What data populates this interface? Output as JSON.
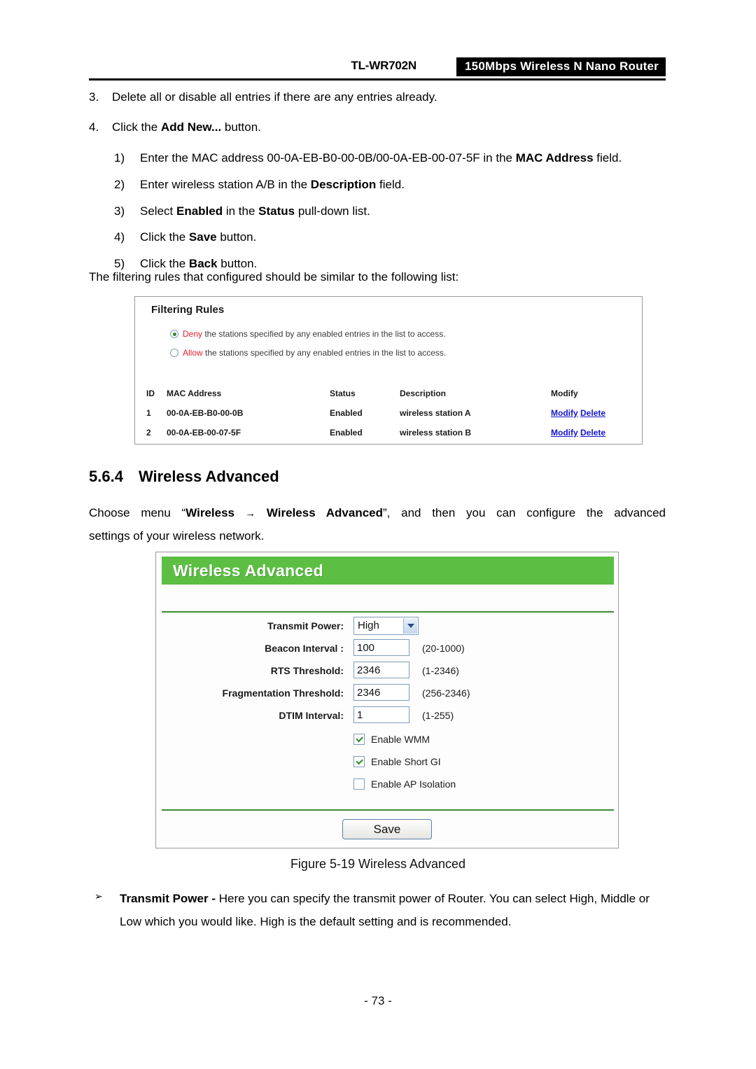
{
  "header": {
    "model": "TL-WR702N",
    "product": "150Mbps  Wireless  N  Nano  Router"
  },
  "outer_steps": [
    {
      "num": "3.",
      "text": "Delete all or disable all entries if there are any entries already."
    },
    {
      "num": "4.",
      "pre": "Click the ",
      "bold": "Add New...",
      "post": " button."
    }
  ],
  "inner_steps": [
    {
      "num": "1)",
      "p1": "Enter the MAC address ",
      "p2": "00-0A-EB-B0-00-0B/00-0A-EB-00-07-5F",
      "p3": " in the ",
      "b1": "MAC Address",
      "p4": " field."
    },
    {
      "num": "2)",
      "p1": "Enter wireless station A/B in the ",
      "b1": "Description",
      "p4": " field."
    },
    {
      "num": "3)",
      "p1": "Select ",
      "b1": "Enabled",
      "p3": " in the ",
      "b2": "Status",
      "p4": " pull-down list."
    },
    {
      "num": "4)",
      "p1": "Click the ",
      "b1": "Save",
      "p4": " button."
    },
    {
      "num": "5)",
      "p1": "Click the ",
      "b1": "Back",
      "p4": " button."
    }
  ],
  "para_filtering": "The filtering rules that configured should be similar to the following list:",
  "filtering_rules": {
    "title": "Filtering Rules",
    "options": [
      {
        "keyword": "Deny",
        "text": " the stations specified by any enabled entries in the list to access.",
        "selected": true
      },
      {
        "keyword": "Allow",
        "text": " the stations specified by any enabled entries in the list to access.",
        "selected": false
      }
    ],
    "columns": [
      "ID",
      "MAC Address",
      "Status",
      "Description",
      "Modify"
    ],
    "rows": [
      {
        "id": "1",
        "mac": "00-0A-EB-B0-00-0B",
        "status": "Enabled",
        "description": "wireless station A",
        "modify": "Modify",
        "delete": "Delete"
      },
      {
        "id": "2",
        "mac": "00-0A-EB-00-07-5F",
        "status": "Enabled",
        "description": "wireless station B",
        "modify": "Modify",
        "delete": "Delete"
      }
    ]
  },
  "section": {
    "number": "5.6.4",
    "title": "Wireless Advanced",
    "para_pre": "Choose menu “",
    "para_b1": "Wireless",
    "para_arrow": "→",
    "para_b2": "Wireless Advanced",
    "para_mid": "”, and then you can configure the advanced",
    "para_line2": "settings of your wireless network."
  },
  "wireless_advanced": {
    "panel_title": "Wireless Advanced",
    "fields": [
      {
        "label": "Transmit Power:",
        "type": "select",
        "value": "High",
        "hint": ""
      },
      {
        "label": "Beacon Interval :",
        "type": "text",
        "value": "100",
        "hint": "(20-1000)"
      },
      {
        "label": "RTS Threshold:",
        "type": "text",
        "value": "2346",
        "hint": "(1-2346)"
      },
      {
        "label": "Fragmentation Threshold:",
        "type": "text",
        "value": "2346",
        "hint": "(256-2346)"
      },
      {
        "label": "DTIM Interval:",
        "type": "text",
        "value": "1",
        "hint": "(1-255)"
      }
    ],
    "checkboxes": [
      {
        "label": "Enable WMM",
        "checked": true
      },
      {
        "label": "Enable Short GI",
        "checked": true
      },
      {
        "label": "Enable AP Isolation",
        "checked": false
      }
    ],
    "save_label": "Save",
    "accent_color": "#5CBE43"
  },
  "figure_caption": "Figure 5-19 Wireless Advanced",
  "bullet": {
    "glyph": "➢",
    "b1": "Transmit Power -",
    "text": " Here you can specify the transmit power of Router. You can select High, Middle or Low which you would like. High is the default setting and is recommended."
  },
  "footer": "- 73 -"
}
